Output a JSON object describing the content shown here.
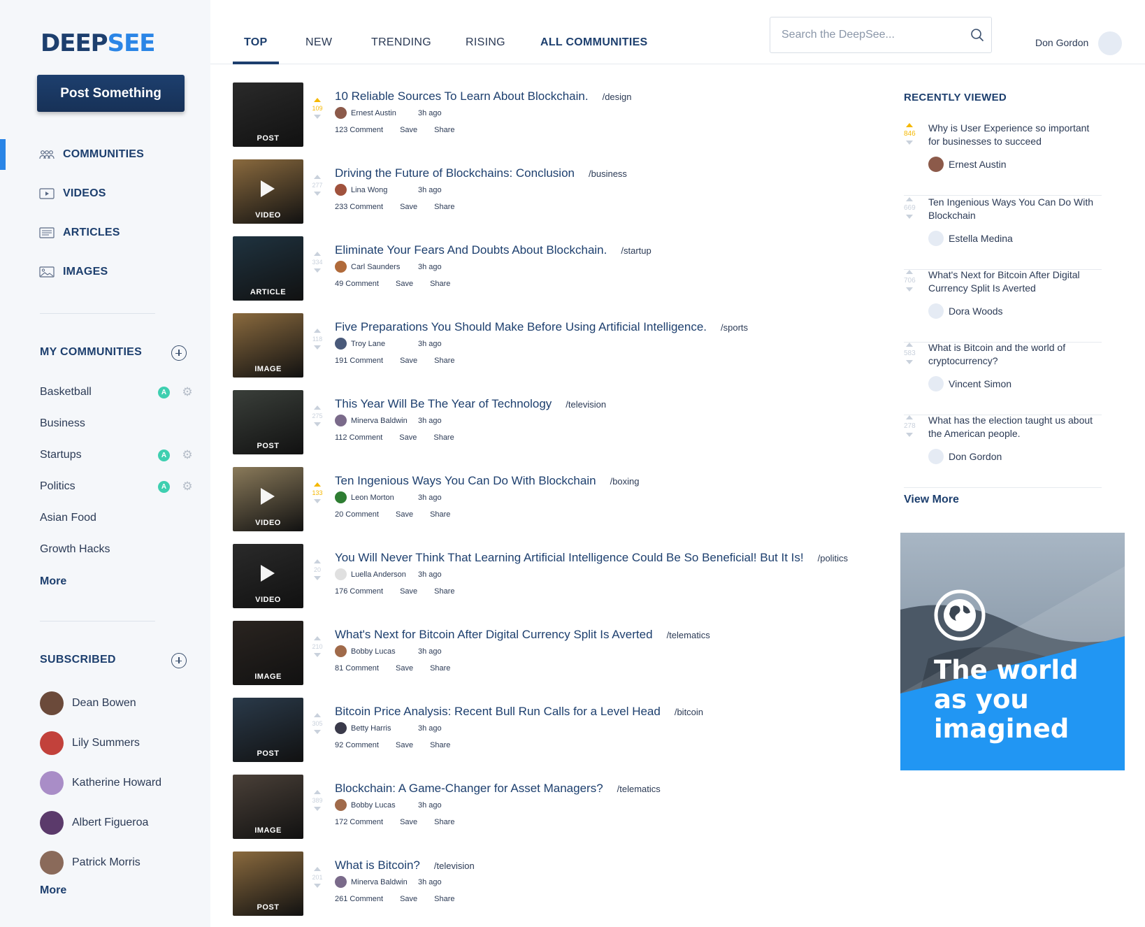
{
  "app": {
    "logo_part1": "DEEP",
    "logo_part2": "SEE",
    "post_button": "Post Something"
  },
  "sidebar": {
    "nav": [
      {
        "label": "COMMUNITIES",
        "icon": "people-icon",
        "active": true
      },
      {
        "label": "VIDEOS",
        "icon": "video-icon",
        "active": false
      },
      {
        "label": "ARTICLES",
        "icon": "article-icon",
        "active": false
      },
      {
        "label": "IMAGES",
        "icon": "image-icon",
        "active": false
      }
    ],
    "my_communities": {
      "title": "MY COMMUNITIES",
      "items": [
        {
          "name": "Basketball",
          "admin": true
        },
        {
          "name": "Business",
          "admin": false
        },
        {
          "name": "Startups",
          "admin": true
        },
        {
          "name": "Politics",
          "admin": true
        },
        {
          "name": "Asian Food",
          "admin": false
        },
        {
          "name": "Growth Hacks",
          "admin": false
        }
      ],
      "admin_badge": "A",
      "more": "More"
    },
    "subscribed": {
      "title": "SUBSCRIBED",
      "items": [
        {
          "name": "Dean Bowen",
          "color": "#6b4a3a"
        },
        {
          "name": "Lily Summers",
          "color": "#c2413b"
        },
        {
          "name": "Katherine Howard",
          "color": "#a98dc7"
        },
        {
          "name": "Albert Figueroa",
          "color": "#5b3a6b"
        },
        {
          "name": "Patrick Morris",
          "color": "#8a6a5a"
        }
      ],
      "more": "More"
    }
  },
  "topbar": {
    "tabs": [
      "TOP",
      "NEW",
      "TRENDING",
      "RISING",
      "ALL COMMUNITIES"
    ],
    "search_placeholder": "Search the DeepSee...",
    "user_name": "Don Gordon"
  },
  "feed": [
    {
      "type": "POST",
      "votes": "109",
      "hot": true,
      "title": "10 Reliable Sources To Learn About Blockchain.",
      "tag": "/design",
      "author": "Ernest Austin",
      "time": "3h ago",
      "comments": "123 Comment",
      "thumb": "#2a2a2a",
      "av": "#8c5a4a"
    },
    {
      "type": "VIDEO",
      "votes": "277",
      "hot": false,
      "title": "Driving the Future of Blockchains: Conclusion",
      "tag": "/business",
      "author": "Lina Wong",
      "time": "3h ago",
      "comments": "233 Comment",
      "thumb": "#8a6a3e",
      "av": "#a0523d"
    },
    {
      "type": "ARTICLE",
      "votes": "334",
      "hot": false,
      "title": "Eliminate Your Fears And Doubts About Blockchain.",
      "tag": "/startup",
      "author": "Carl Saunders",
      "time": "3h ago",
      "comments": "49 Comment",
      "thumb": "#1f3340",
      "av": "#b06a3a"
    },
    {
      "type": "IMAGE",
      "votes": "118",
      "hot": false,
      "title": "Five Preparations You Should Make Before Using Artificial Intelligence.",
      "tag": "/sports",
      "author": "Troy Lane",
      "time": "3h ago",
      "comments": "191 Comment",
      "thumb": "#8a6a3e",
      "av": "#4a5a7a"
    },
    {
      "type": "POST",
      "votes": "275",
      "hot": false,
      "title": "This Year Will Be The Year of Technology",
      "tag": "/television",
      "author": "Minerva Baldwin",
      "time": "3h ago",
      "comments": "112 Comment",
      "thumb": "#3a3f3a",
      "av": "#7a6a8a"
    },
    {
      "type": "VIDEO",
      "votes": "133",
      "hot": true,
      "title": "Ten Ingenious Ways You Can Do With Blockchain",
      "tag": "/boxing",
      "author": "Leon Morton",
      "time": "3h ago",
      "comments": "20 Comment",
      "thumb": "#8a7a5a",
      "av": "#2e7d32"
    },
    {
      "type": "VIDEO",
      "votes": "20",
      "hot": false,
      "title": "You Will Never Think That Learning Artificial Intelligence Could Be So Beneficial! But It Is!",
      "tag": "/politics",
      "author": "Luella Anderson",
      "time": "3h ago",
      "comments": "176 Comment",
      "thumb": "#2a2a2a",
      "av": "#e0e0e0"
    },
    {
      "type": "IMAGE",
      "votes": "210",
      "hot": false,
      "title": "What's Next for Bitcoin After Digital Currency Split Is Averted",
      "tag": "/telematics",
      "author": "Bobby Lucas",
      "time": "3h ago",
      "comments": "81 Comment",
      "thumb": "#2a2420",
      "av": "#a06a4a"
    },
    {
      "type": "POST",
      "votes": "305",
      "hot": false,
      "title": "Bitcoin Price Analysis: Recent Bull Run Calls for a Level Head",
      "tag": "/bitcoin",
      "author": "Betty Harris",
      "time": "3h ago",
      "comments": "92 Comment",
      "thumb": "#2a3a4a",
      "av": "#3a3a4a"
    },
    {
      "type": "IMAGE",
      "votes": "389",
      "hot": false,
      "title": "Blockchain: A Game-Changer for Asset Managers?",
      "tag": "/telematics",
      "author": "Bobby Lucas",
      "time": "3h ago",
      "comments": "172 Comment",
      "thumb": "#4a4038",
      "av": "#a06a4a"
    },
    {
      "type": "POST",
      "votes": "201",
      "hot": false,
      "title": "What is Bitcoin?",
      "tag": "/television",
      "author": "Minerva Baldwin",
      "time": "3h ago",
      "comments": "261 Comment",
      "thumb": "#8a6a3e",
      "av": "#7a6a8a"
    }
  ],
  "feed_actions": {
    "save": "Save",
    "share": "Share"
  },
  "recently_viewed": {
    "title": "RECENTLY VIEWED",
    "items": [
      {
        "votes": "846",
        "hot": true,
        "title": "Why is User Experience so important for businesses to succeed",
        "author": "Ernest Austin",
        "av": "#8c5a4a"
      },
      {
        "votes": "669",
        "hot": false,
        "title": "Ten Ingenious Ways You Can Do With Blockchain",
        "author": "Estella Medina",
        "av": "#e5ebf4"
      },
      {
        "votes": "706",
        "hot": false,
        "title": "What's Next for Bitcoin After Digital Currency Split Is Averted",
        "author": "Dora Woods",
        "av": "#e5ebf4"
      },
      {
        "votes": "583",
        "hot": false,
        "title": "What is Bitcoin and the world of cryptocurrency?",
        "author": "Vincent Simon",
        "av": "#e5ebf4"
      },
      {
        "votes": "278",
        "hot": false,
        "title": "What has the election taught us about the American people.",
        "author": "Don Gordon",
        "av": "#e5ebf4"
      }
    ],
    "view_more": "View More"
  },
  "ad": {
    "line1": "The world",
    "line2": "as you",
    "line3": "imagined"
  }
}
